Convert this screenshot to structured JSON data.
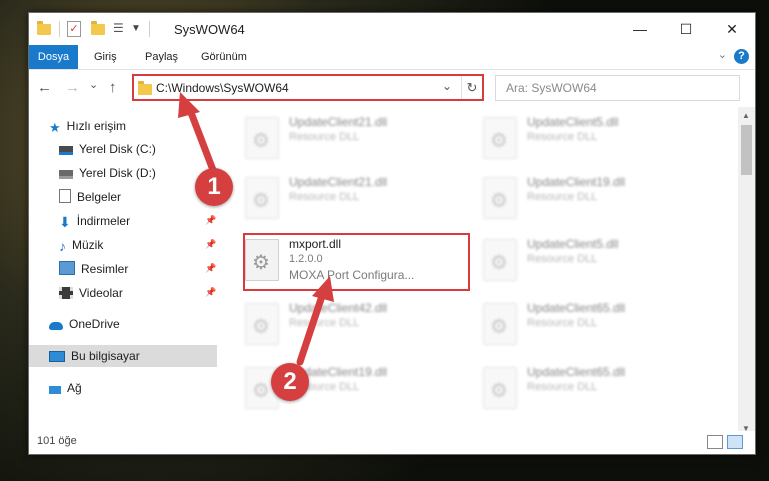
{
  "window": {
    "title": "SysWOW64",
    "minimize": "—",
    "maximize": "☐",
    "close": "✕"
  },
  "ribbon": {
    "tabs": [
      "Dosya",
      "Giriş",
      "Paylaş",
      "Görünüm"
    ],
    "help": "?"
  },
  "nav": {
    "back": "←",
    "forward": "→",
    "recent": "⌄",
    "up": "↑",
    "address": "C:\\Windows\\SysWOW64",
    "address_drop": "⌄",
    "refresh": "↻",
    "search_placeholder": "Ara: SysWOW64"
  },
  "sidebar": {
    "items": [
      {
        "label": "Hızlı erişim",
        "icon": "star-icon",
        "pinned": false
      },
      {
        "label": "Yerel Disk (C:)",
        "icon": "drive-icon",
        "pinned": false
      },
      {
        "label": "Yerel Disk (D:)",
        "icon": "drive-icon",
        "pinned": false
      },
      {
        "label": "Belgeler",
        "icon": "document-icon",
        "pinned": false
      },
      {
        "label": "İndirmeler",
        "icon": "download-icon",
        "pinned": true
      },
      {
        "label": "Müzik",
        "icon": "music-icon",
        "pinned": true
      },
      {
        "label": "Resimler",
        "icon": "pictures-icon",
        "pinned": true
      },
      {
        "label": "Videolar",
        "icon": "videos-icon",
        "pinned": true
      },
      {
        "label": "OneDrive",
        "icon": "cloud-icon",
        "pinned": false
      },
      {
        "label": "Bu bilgisayar",
        "icon": "computer-icon",
        "pinned": false
      },
      {
        "label": "Ağ",
        "icon": "network-icon",
        "pinned": false
      }
    ]
  },
  "files": {
    "left": [
      {
        "name": "UpdateClient21.dll",
        "line1": "Resource DLL",
        "line2": ""
      },
      {
        "name": "UpdateClient21.dll",
        "line1": "Resource DLL",
        "line2": ""
      },
      {
        "name": "mxport.dll",
        "line1": "1.2.0.0",
        "line2": "MOXA Port Configura..."
      },
      {
        "name": "UpdateClient42.dll",
        "line1": "Resource DLL",
        "line2": ""
      },
      {
        "name": "UpdateClient19.dll",
        "line1": "Resource DLL",
        "line2": ""
      }
    ],
    "right": [
      {
        "name": "UpdateClient5.dll",
        "line1": "Resource DLL"
      },
      {
        "name": "UpdateClient19.dll",
        "line1": "Resource DLL"
      },
      {
        "name": "UpdateClient5.dll",
        "line1": "Resource DLL"
      },
      {
        "name": "UpdateClient65.dll",
        "line1": "Resource DLL"
      },
      {
        "name": "UpdateClient65.dll",
        "line1": "Resource DLL"
      }
    ]
  },
  "status": {
    "count": "101 öğe"
  },
  "annotations": {
    "step1": "1",
    "step2": "2",
    "color": "#d63f3f"
  }
}
